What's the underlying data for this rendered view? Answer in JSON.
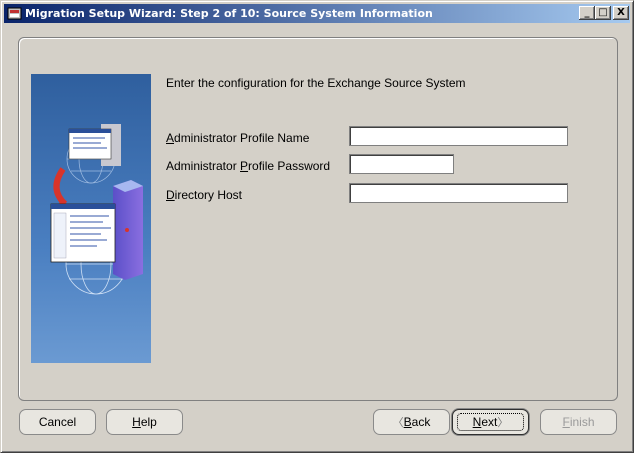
{
  "window": {
    "title": "Migration Setup Wizard:  Step 2 of 10: Source System Information",
    "controls": {
      "minimize": "_",
      "maximize": "□",
      "close": "X"
    }
  },
  "main": {
    "intro": "Enter the configuration for the Exchange Source System",
    "fields": [
      {
        "mnemonic": "A",
        "label_rest": "dministrator Profile Name",
        "value": ""
      },
      {
        "label_prefix": "Administrator ",
        "mnemonic": "P",
        "label_rest": "rofile Password",
        "value": ""
      },
      {
        "mnemonic": "D",
        "label_rest": "irectory Host",
        "value": ""
      }
    ]
  },
  "buttons": {
    "cancel": "Cancel",
    "help_mnemonic": "H",
    "help_rest": "elp",
    "back_chevron": "〈",
    "back_mnemonic": "B",
    "back_rest": "ack",
    "next_mnemonic": "N",
    "next_rest": "ext",
    "next_chevron": "〉",
    "finish_mnemonic": "F",
    "finish_rest": "inish"
  },
  "colors": {
    "titlebar_start": "#0a246a",
    "titlebar_end": "#a6caf0",
    "graphic_blue": "#3d6fb3",
    "window_bg": "#d4d0c8"
  },
  "icons": [
    "app-icon",
    "minimize-icon",
    "maximize-icon",
    "close-icon",
    "migration-graphic"
  ]
}
